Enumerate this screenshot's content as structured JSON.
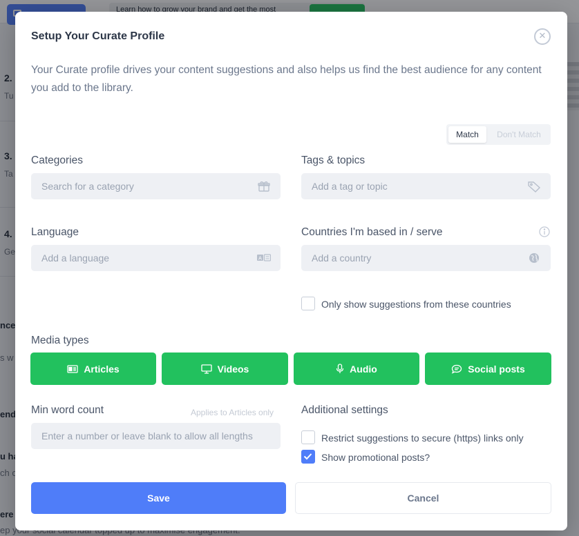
{
  "background": {
    "promo_text": "Learn how to grow your brand and get the most",
    "steps": [
      {
        "number": "2.",
        "sub": "Tu"
      },
      {
        "number": "3.",
        "sub": "Ta"
      },
      {
        "number": "4.",
        "sub": "Ge"
      }
    ],
    "fragments": [
      "nce",
      "s w",
      "end",
      "u ha",
      "ch c",
      "ere",
      "ep your social calendar topped up to maximise engagement."
    ]
  },
  "modal": {
    "title": "Setup Your Curate Profile",
    "description": "Your Curate profile drives your content suggestions and also helps us find the best audience for any content you add to the library.",
    "match_toggle": {
      "match": "Match",
      "dont_match": "Don't Match"
    },
    "categories": {
      "label": "Categories",
      "placeholder": "Search for a category",
      "icon": "gift-icon"
    },
    "tags": {
      "label": "Tags & topics",
      "placeholder": "Add a tag or topic",
      "icon": "tag-icon"
    },
    "language": {
      "label": "Language",
      "placeholder": "Add a language",
      "icon": "translate-icon"
    },
    "countries": {
      "label": "Countries I'm based in / serve",
      "placeholder": "Add a country",
      "icon": "globe-icon"
    },
    "only_countries": {
      "label": "Only show suggestions from these countries",
      "checked": false
    },
    "media_types": {
      "label": "Media types",
      "items": [
        {
          "label": "Articles",
          "icon": "newspaper-icon"
        },
        {
          "label": "Videos",
          "icon": "monitor-icon"
        },
        {
          "label": "Audio",
          "icon": "microphone-icon"
        },
        {
          "label": "Social posts",
          "icon": "chat-bubble-icon"
        }
      ]
    },
    "min_word_count": {
      "label": "Min word count",
      "hint": "Applies to Articles only",
      "placeholder": "Enter a number or leave blank to allow all lengths"
    },
    "additional_settings": {
      "label": "Additional settings",
      "options": [
        {
          "label": "Restrict suggestions to secure (https) links only",
          "checked": false
        },
        {
          "label": "Show promotional posts?",
          "checked": true
        }
      ]
    },
    "save_label": "Save",
    "cancel_label": "Cancel"
  },
  "colors": {
    "primary": "#4f7df9",
    "success": "#22c15e",
    "field_bg": "#eef0f4"
  }
}
